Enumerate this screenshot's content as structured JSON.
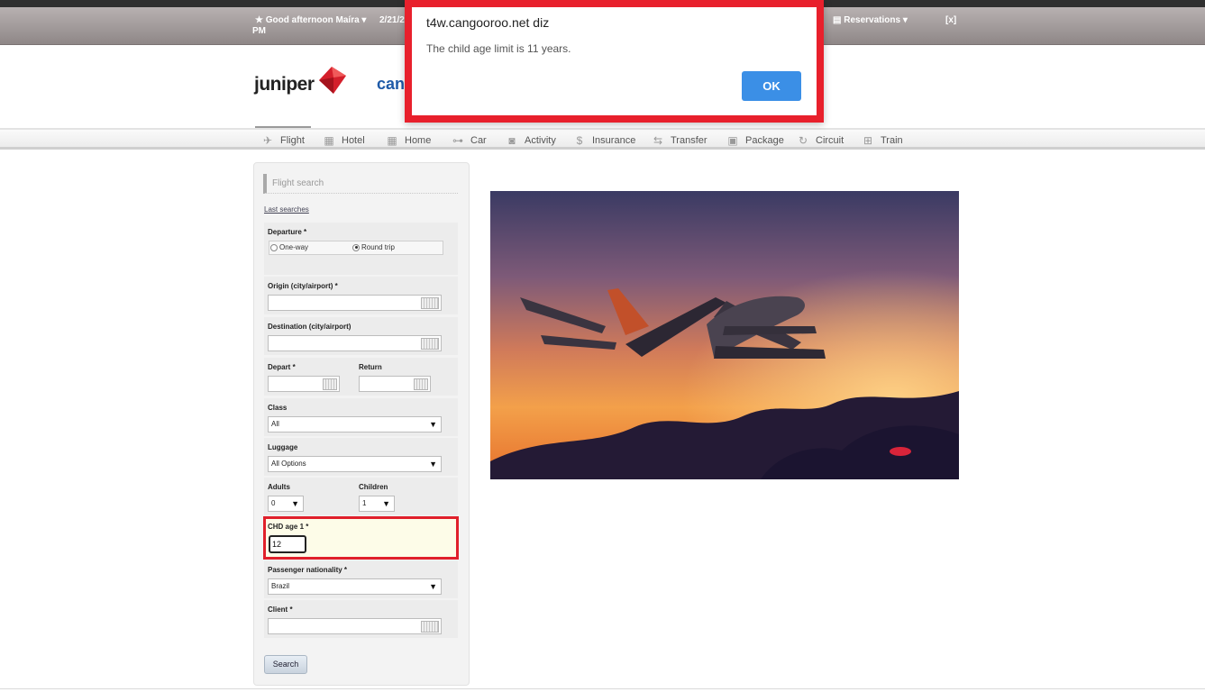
{
  "topbar": {
    "greeting": "Good afternoon Maíra",
    "date_fragment": "2/21/2",
    "pm_label": "PM",
    "reservations": "Reservations",
    "close_label": "[x]"
  },
  "logo": {
    "brand": "juniper",
    "partner": "cangoor"
  },
  "nav": {
    "items": [
      {
        "label": "Flight",
        "icon": "plane-icon"
      },
      {
        "label": "Hotel",
        "icon": "building-icon"
      },
      {
        "label": "Home",
        "icon": "building-icon"
      },
      {
        "label": "Car",
        "icon": "car-icon"
      },
      {
        "label": "Activity",
        "icon": "camera-icon"
      },
      {
        "label": "Insurance",
        "icon": "dollar-icon"
      },
      {
        "label": "Transfer",
        "icon": "transfer-icon"
      },
      {
        "label": "Package",
        "icon": "briefcase-icon"
      },
      {
        "label": "Circuit",
        "icon": "cycle-icon"
      },
      {
        "label": "Train",
        "icon": "train-icon"
      }
    ]
  },
  "form": {
    "title": "Flight search",
    "last_searches": "Last searches",
    "departure_label": "Departure *",
    "one_way": "One-way",
    "round_trip": "Round trip",
    "origin_label": "Origin (city/airport) *",
    "destination_label": "Destination (city/airport)",
    "depart_label": "Depart *",
    "return_label": "Return",
    "class_label": "Class",
    "class_value": "All",
    "luggage_label": "Luggage",
    "luggage_value": "All Options",
    "adults_label": "Adults",
    "adults_value": "0",
    "children_label": "Children",
    "children_value": "1",
    "chd_age_label": "CHD age 1 *",
    "chd_age_value": "12",
    "nationality_label": "Passenger nationality *",
    "nationality_value": "Brazil",
    "client_label": "Client *",
    "search_button": "Search"
  },
  "dialog": {
    "title": "t4w.cangooroo.net diz",
    "message": "The child age limit is 11 years.",
    "ok": "OK"
  },
  "colors": {
    "highlight_red": "#e8202c",
    "ok_blue": "#3b8fe6"
  }
}
